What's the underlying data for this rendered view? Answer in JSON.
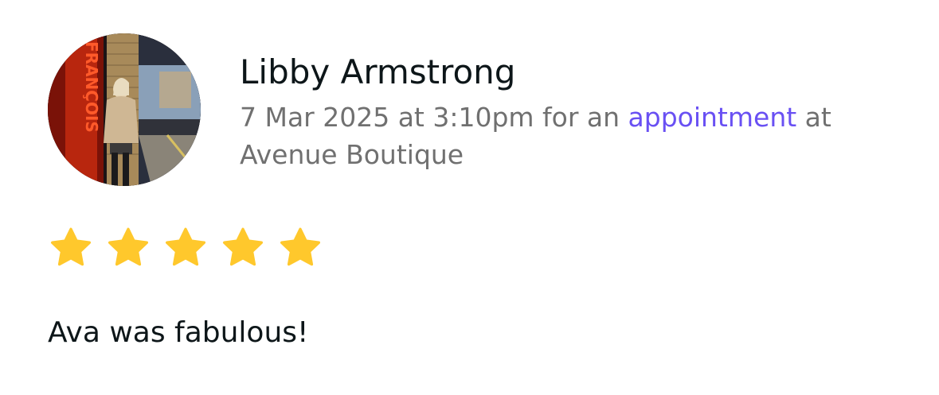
{
  "review": {
    "reviewer_name": "Libby Armstrong",
    "avatar_sign_text": "FRANÇOIS",
    "date_time": "7 Mar 2025 at 3:10pm",
    "for_text": " for an ",
    "link_text": "appointment",
    "at_text": " at ",
    "venue": "Avenue Boutique",
    "rating": 5,
    "rating_max": 5,
    "text": "Ava was fabulous!"
  },
  "colors": {
    "star": "#ffc82c",
    "link": "#6950f3",
    "secondary_text": "#707070",
    "primary_text": "#0d1619"
  },
  "icons": {
    "star": "star-icon"
  }
}
